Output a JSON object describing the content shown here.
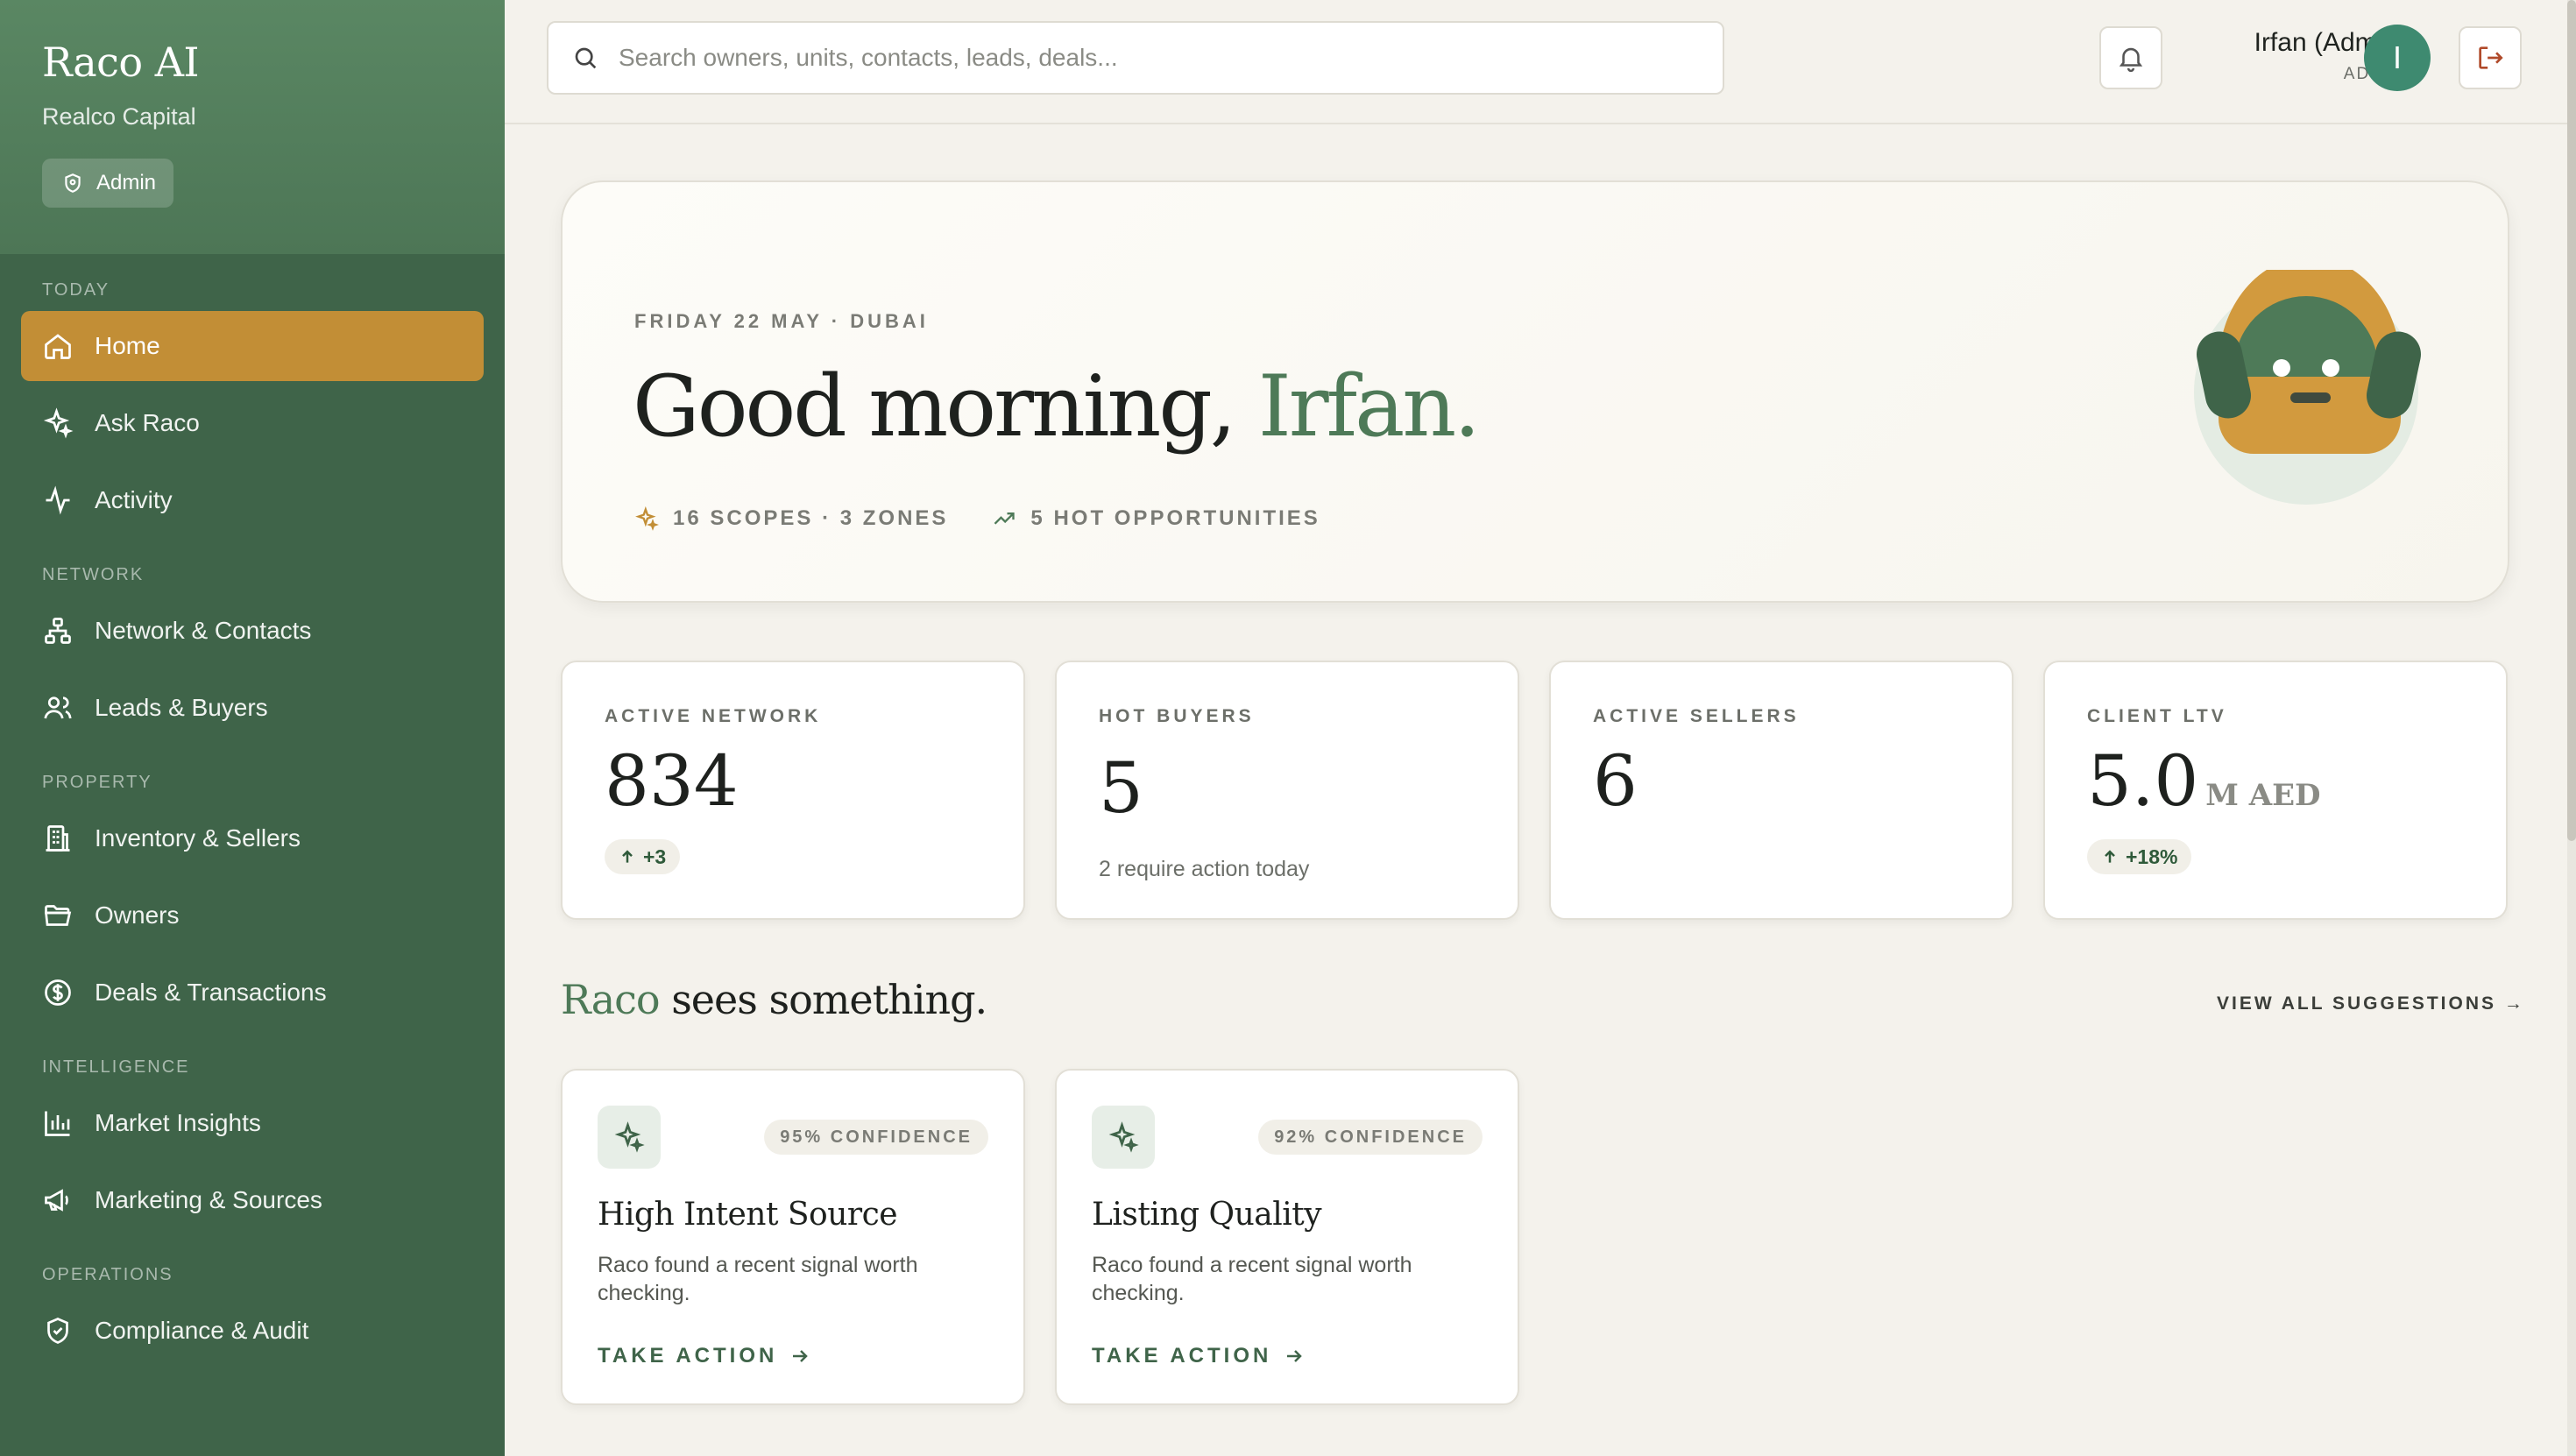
{
  "sidebar": {
    "brand": "Raco AI",
    "org": "Realco Capital",
    "role_pill": "Admin",
    "sections": [
      {
        "title": "TODAY",
        "items": [
          {
            "label": "Home",
            "icon": "home-icon",
            "active": true
          },
          {
            "label": "Ask Raco",
            "icon": "sparkle-icon"
          },
          {
            "label": "Activity",
            "icon": "activity-icon"
          }
        ]
      },
      {
        "title": "NETWORK",
        "items": [
          {
            "label": "Network & Contacts",
            "icon": "network-icon"
          },
          {
            "label": "Leads & Buyers",
            "icon": "users-icon"
          }
        ]
      },
      {
        "title": "PROPERTY",
        "items": [
          {
            "label": "Inventory & Sellers",
            "icon": "building-icon"
          },
          {
            "label": "Owners",
            "icon": "folder-icon"
          },
          {
            "label": "Deals & Transactions",
            "icon": "dollar-icon"
          }
        ]
      },
      {
        "title": "INTELLIGENCE",
        "items": [
          {
            "label": "Market Insights",
            "icon": "bar-chart-icon"
          },
          {
            "label": "Marketing & Sources",
            "icon": "megaphone-icon"
          }
        ]
      },
      {
        "title": "OPERATIONS",
        "items": [
          {
            "label": "Compliance & Audit",
            "icon": "shield-icon"
          }
        ]
      }
    ]
  },
  "topbar": {
    "search_placeholder": "Search owners, units, contacts, leads, deals...",
    "user_name": "Irfan (Admin)",
    "user_role": "ADMIN",
    "avatar_initial": "I"
  },
  "hero": {
    "date": "FRIDAY 22 MAY · DUBAI",
    "greeting": "Good morning, ",
    "name": "Irfan.",
    "meta_scopes": "16 SCOPES · 3 ZONES",
    "meta_opps": "5 HOT OPPORTUNITIES"
  },
  "stats": [
    {
      "label": "ACTIVE NETWORK",
      "value": "834",
      "badge": "+3"
    },
    {
      "label": "HOT BUYERS",
      "value": "5",
      "sub": "2 require action today"
    },
    {
      "label": "ACTIVE SELLERS",
      "value": "6"
    },
    {
      "label": "CLIENT LTV",
      "value": "5.0",
      "unit": "M AED",
      "badge": "+18%"
    }
  ],
  "suggestions_header": {
    "accent": "Raco",
    "rest": " sees something.",
    "view_all": "VIEW ALL SUGGESTIONS →"
  },
  "suggestions": [
    {
      "confidence": "95% CONFIDENCE",
      "title": "High Intent Source",
      "desc": "Raco found a recent signal worth checking.",
      "action": "TAKE ACTION"
    },
    {
      "confidence": "92% CONFIDENCE",
      "title": "Listing Quality",
      "desc": "Raco found a recent signal worth checking.",
      "action": "TAKE ACTION"
    }
  ],
  "colors": {
    "sidebar": "#3f6449",
    "active_nav": "#c28e36",
    "accent_green": "#4e7a58",
    "avatar": "#3e8a70"
  }
}
